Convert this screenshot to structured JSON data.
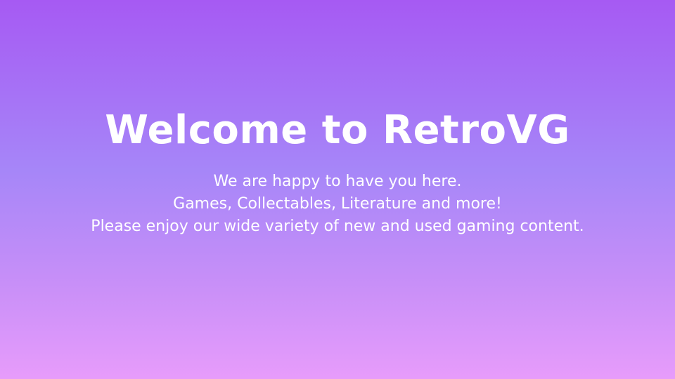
{
  "hero": {
    "title": "Welcome to RetroVG",
    "lines": [
      "We are happy to have you here.",
      "Games, Collectables, Literature and more!",
      "Please enjoy our wide variety of new and used gaming content."
    ]
  },
  "colors": {
    "gradient_top": "#a65af3",
    "gradient_middle": "#a686f8",
    "gradient_lower": "#c88ff8",
    "gradient_bottom": "#e79cfb",
    "text": "#ffffff"
  }
}
